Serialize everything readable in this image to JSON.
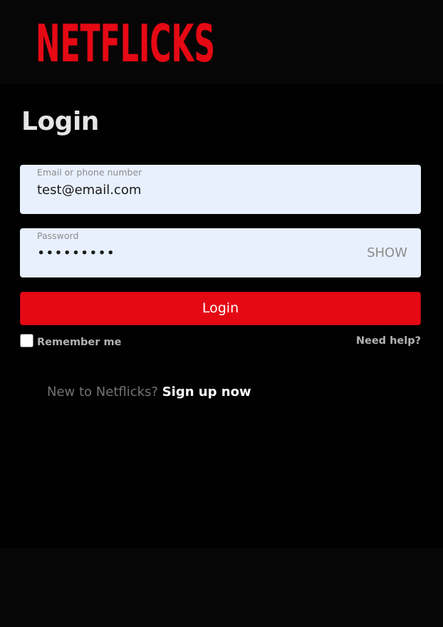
{
  "brand": {
    "logo_text": "NETFLICKS",
    "logo_color": "#e50914"
  },
  "login": {
    "title": "Login",
    "email": {
      "label": "Email or phone number",
      "value": "test@email.com"
    },
    "password": {
      "label": "Password",
      "masked_value": "•••••••••",
      "show_label": "SHOW"
    },
    "submit_label": "Login",
    "remember_me_label": "Remember me",
    "remember_me_checked": false,
    "need_help_label": "Need help?",
    "signup_prompt": "New to Netflicks?",
    "signup_link": "Sign up now"
  },
  "colors": {
    "background": "#000000",
    "header_footer_background": "#060606",
    "input_background": "#e8f0fe",
    "button_background": "#e50914",
    "muted_text": "#737373"
  }
}
